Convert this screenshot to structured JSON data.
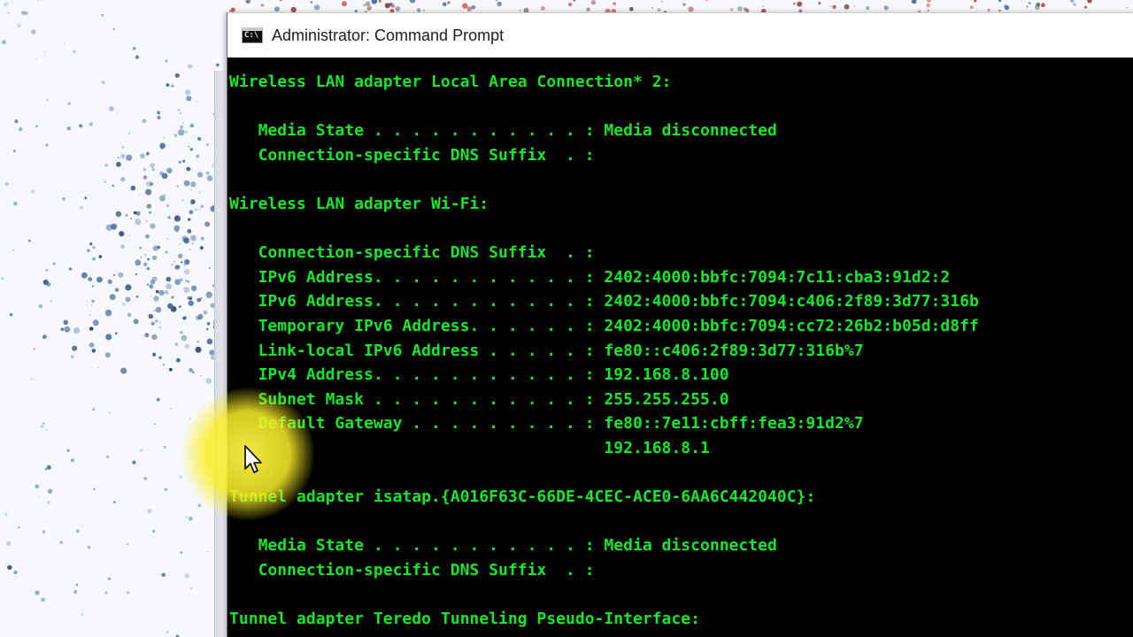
{
  "window": {
    "title": "Administrator: Command Prompt",
    "icon": "cmd-icon",
    "icon_glyph": "C:\\"
  },
  "console": {
    "lines": [
      "Wireless LAN adapter Local Area Connection* 2:",
      "",
      "   Media State . . . . . . . . . . . : Media disconnected",
      "   Connection-specific DNS Suffix  . :",
      "",
      "Wireless LAN adapter Wi-Fi:",
      "",
      "   Connection-specific DNS Suffix  . :",
      "   IPv6 Address. . . . . . . . . . . : 2402:4000:bbfc:7094:7c11:cba3:91d2:2",
      "   IPv6 Address. . . . . . . . . . . : 2402:4000:bbfc:7094:c406:2f89:3d77:316b",
      "   Temporary IPv6 Address. . . . . . : 2402:4000:bbfc:7094:cc72:26b2:b05d:d8ff",
      "   Link-local IPv6 Address . . . . . : fe80::c406:2f89:3d77:316b%7",
      "   IPv4 Address. . . . . . . . . . . : 192.168.8.100",
      "   Subnet Mask . . . . . . . . . . . : 255.255.255.0",
      "   Default Gateway . . . . . . . . . : fe80::7e11:cbff:fea3:91d2%7",
      "                                       192.168.8.1",
      "",
      "Tunnel adapter isatap.{A016F63C-66DE-4CEC-ACE0-6AA6C442040C}:",
      "",
      "   Media State . . . . . . . . . . . : Media disconnected",
      "   Connection-specific DNS Suffix  . :",
      "",
      "Tunnel adapter Teredo Tunneling Pseudo-Interface:"
    ]
  },
  "colors": {
    "console_text": "#16e62c",
    "console_background": "#000000",
    "cursor_highlight": "#f8ec2a"
  },
  "pointer": {
    "icon": "mouse-pointer-icon"
  }
}
